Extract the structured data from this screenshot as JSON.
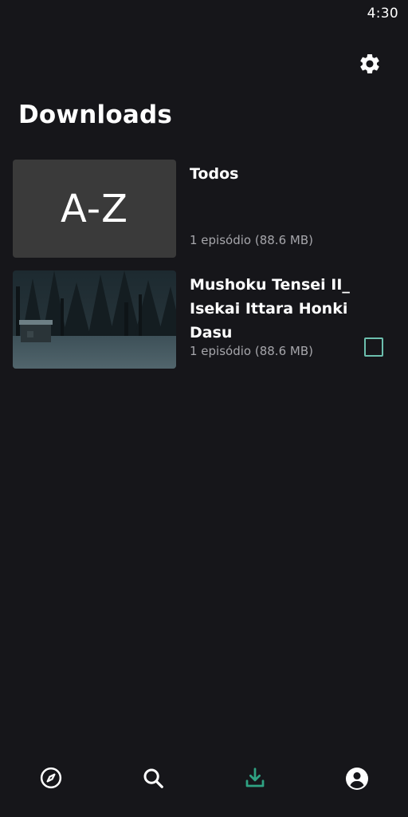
{
  "status_bar": {
    "time": "4:30"
  },
  "header": {
    "title": "Downloads"
  },
  "downloads": [
    {
      "thumb_text": "A-Z",
      "title": "Todos",
      "meta": "1 episódio (88.6 MB)"
    },
    {
      "title": "Mushoku Tensei II_ Isekai Ittara Honki Dasu",
      "meta": "1 episódio (88.6 MB)"
    }
  ],
  "icons": {
    "settings": "gear-icon",
    "nav": [
      "compass-icon",
      "search-icon",
      "download-icon",
      "account-icon"
    ]
  },
  "colors": {
    "background": "#16161a",
    "accent": "#2fa383",
    "checkbox": "#6cbfae",
    "muted_text": "#a6a6ab"
  },
  "bottom_nav": {
    "active_index": 2
  }
}
